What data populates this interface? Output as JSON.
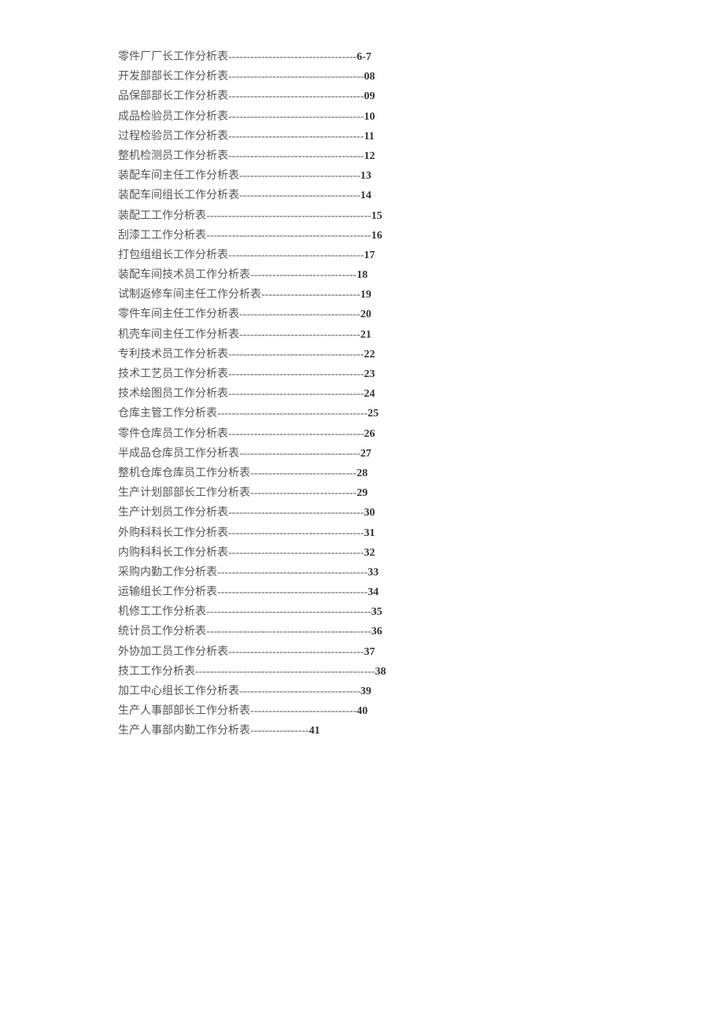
{
  "toc": [
    {
      "title": "零件厂厂长工作分析表",
      "dashes": "-----------------------------------",
      "page": "6-7"
    },
    {
      "title": "开发部部长工作分析表",
      "dashes": "-------------------------------------",
      "page": "08"
    },
    {
      "title": "品保部部长工作分析表",
      "dashes": "-------------------------------------",
      "page": "09"
    },
    {
      "title": "成品检验员工作分析表",
      "dashes": "-------------------------------------",
      "page": "10"
    },
    {
      "title": "过程检验员工作分析表",
      "dashes": "-------------------------------------",
      "page": "11"
    },
    {
      "title": "整机检测员工作分析表",
      "dashes": "-------------------------------------",
      "page": "12"
    },
    {
      "title": "装配车间主任工作分析表",
      "dashes": "---------------------------------",
      "page": "13"
    },
    {
      "title": "装配车间组长工作分析表",
      "dashes": "---------------------------------",
      "page": "14"
    },
    {
      "title": "装配工工作分析表",
      "dashes": "---------------------------------------------",
      "page": "15"
    },
    {
      "title": "刮漆工工作分析表",
      "dashes": "---------------------------------------------",
      "page": "16"
    },
    {
      "title": "打包组组长工作分析表",
      "dashes": "-------------------------------------",
      "page": "17"
    },
    {
      "title": "装配车间技术员工作分析表",
      "dashes": "-----------------------------",
      "page": "18"
    },
    {
      "title": "试制返修车间主任工作分析表",
      "dashes": "---------------------------",
      "page": "19"
    },
    {
      "title": "零件车间主任工作分析表",
      "dashes": "---------------------------------",
      "page": "20"
    },
    {
      "title": "机壳车间主任工作分析表",
      "dashes": "---------------------------------",
      "page": "21"
    },
    {
      "title": "专利技术员工作分析表",
      "dashes": "-------------------------------------",
      "page": "22"
    },
    {
      "title": "技术工艺员工作分析表",
      "dashes": "-------------------------------------",
      "page": "23"
    },
    {
      "title": "技术绘图员工作分析表",
      "dashes": "-------------------------------------",
      "page": "24"
    },
    {
      "title": "仓库主管工作分析表",
      "dashes": "-----------------------------------------",
      "page": "25"
    },
    {
      "title": "零件仓库员工作分析表",
      "dashes": "-------------------------------------",
      "page": "26"
    },
    {
      "title": "半成品仓库员工作分析表",
      "dashes": "---------------------------------",
      "page": "27"
    },
    {
      "title": "整机仓库仓库员工作分析表",
      "dashes": "-----------------------------",
      "page": "28"
    },
    {
      "title": "生产计划部部长工作分析表",
      "dashes": "-----------------------------",
      "page": "29"
    },
    {
      "title": "生产计划员工作分析表",
      "dashes": "-------------------------------------",
      "page": "30"
    },
    {
      "title": "外购科科长工作分析表",
      "dashes": "-------------------------------------",
      "page": "31"
    },
    {
      "title": "内购科科长工作分析表",
      "dashes": "-------------------------------------",
      "page": "32"
    },
    {
      "title": "采购内勤工作分析表",
      "dashes": "-----------------------------------------",
      "page": "33"
    },
    {
      "title": "运输组长工作分析表",
      "dashes": "-----------------------------------------",
      "page": "34"
    },
    {
      "title": "机修工工作分析表",
      "dashes": "---------------------------------------------",
      "page": "35"
    },
    {
      "title": "统计员工作分析表",
      "dashes": "---------------------------------------------",
      "page": "36"
    },
    {
      "title": "外协加工员工作分析表",
      "dashes": "-------------------------------------",
      "page": "37"
    },
    {
      "title": "技工工作分析表",
      "dashes": "-------------------------------------------------",
      "page": "38"
    },
    {
      "title": "加工中心组长工作分析表",
      "dashes": "---------------------------------",
      "page": "39"
    },
    {
      "title": "生产人事部部长工作分析表",
      "dashes": "-----------------------------",
      "page": "40"
    },
    {
      "title": "生产人事部内勤工作分析表",
      "dashes": "----------------",
      "page": "41"
    }
  ]
}
